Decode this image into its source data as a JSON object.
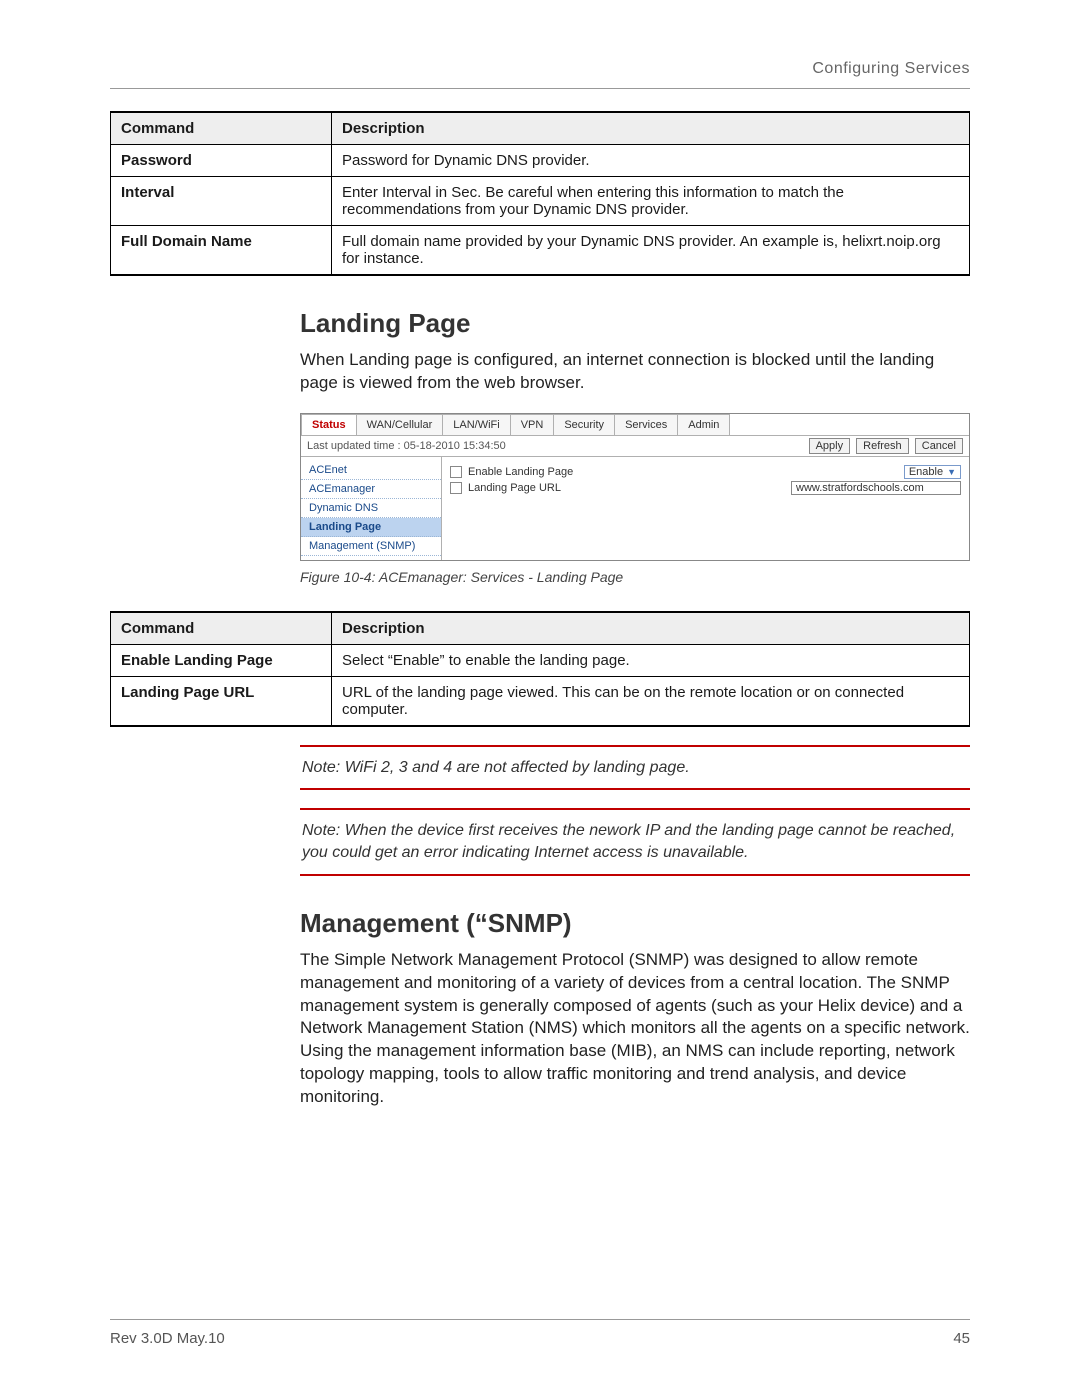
{
  "header": {
    "running": "Configuring Services"
  },
  "table1": {
    "headers": [
      "Command",
      "Description"
    ],
    "rows": [
      {
        "cmd": "Password",
        "desc": "Password for Dynamic DNS provider."
      },
      {
        "cmd": "Interval",
        "desc": "Enter Interval in Sec. Be careful when entering this information to match the recommendations from your Dynamic DNS provider."
      },
      {
        "cmd": "Full Domain Name",
        "desc": "Full domain name provided by your Dynamic DNS provider. An example is, helixrt.noip.org for instance."
      }
    ]
  },
  "landing": {
    "heading": "Landing Page",
    "intro": "When Landing page is configured, an internet connection is blocked until the landing page is viewed from the web browser."
  },
  "figure": {
    "tabs": [
      "Status",
      "WAN/Cellular",
      "LAN/WiFi",
      "VPN",
      "Security",
      "Services",
      "Admin"
    ],
    "active_tab_index": 0,
    "timestamp": "Last updated time : 05-18-2010 15:34:50",
    "buttons": {
      "apply": "Apply",
      "refresh": "Refresh",
      "cancel": "Cancel"
    },
    "side": [
      "ACEnet",
      "ACEmanager",
      "Dynamic DNS",
      "Landing Page",
      "Management (SNMP)"
    ],
    "side_selected_index": 3,
    "rows": {
      "enable_label": "Enable Landing Page",
      "enable_value": "Enable",
      "url_label": "Landing Page URL",
      "url_value": "www.stratfordschools.com"
    },
    "caption": "Figure 10-4: ACEmanager: Services - Landing Page"
  },
  "table2": {
    "headers": [
      "Command",
      "Description"
    ],
    "rows": [
      {
        "cmd": "Enable Landing Page",
        "desc": "Select “Enable” to enable the landing page."
      },
      {
        "cmd": "Landing Page URL",
        "desc": "URL of the landing page viewed. This can be on the remote location or on connected computer."
      }
    ]
  },
  "note1": "Note:  WiFi 2, 3 and 4 are not affected by landing page.",
  "note2": "Note:  When the device first receives the nework IP and the landing page cannot be reached, you could get an error indicating Internet access is unavailable.",
  "snmp": {
    "heading": "Management (“SNMP)",
    "body": "The Simple Network Management Protocol (SNMP) was designed to allow remote management and monitoring of a variety of devices from a central location. The SNMP management system is generally composed of agents (such as your Helix device) and a Network Management Station (NMS) which monitors all the agents on a specific network. Using the management information base (MIB), an NMS can include reporting, network topology mapping, tools to allow traffic monitoring and trend analysis, and device monitoring."
  },
  "footer": {
    "rev": "Rev 3.0D  May.10",
    "page": "45"
  }
}
